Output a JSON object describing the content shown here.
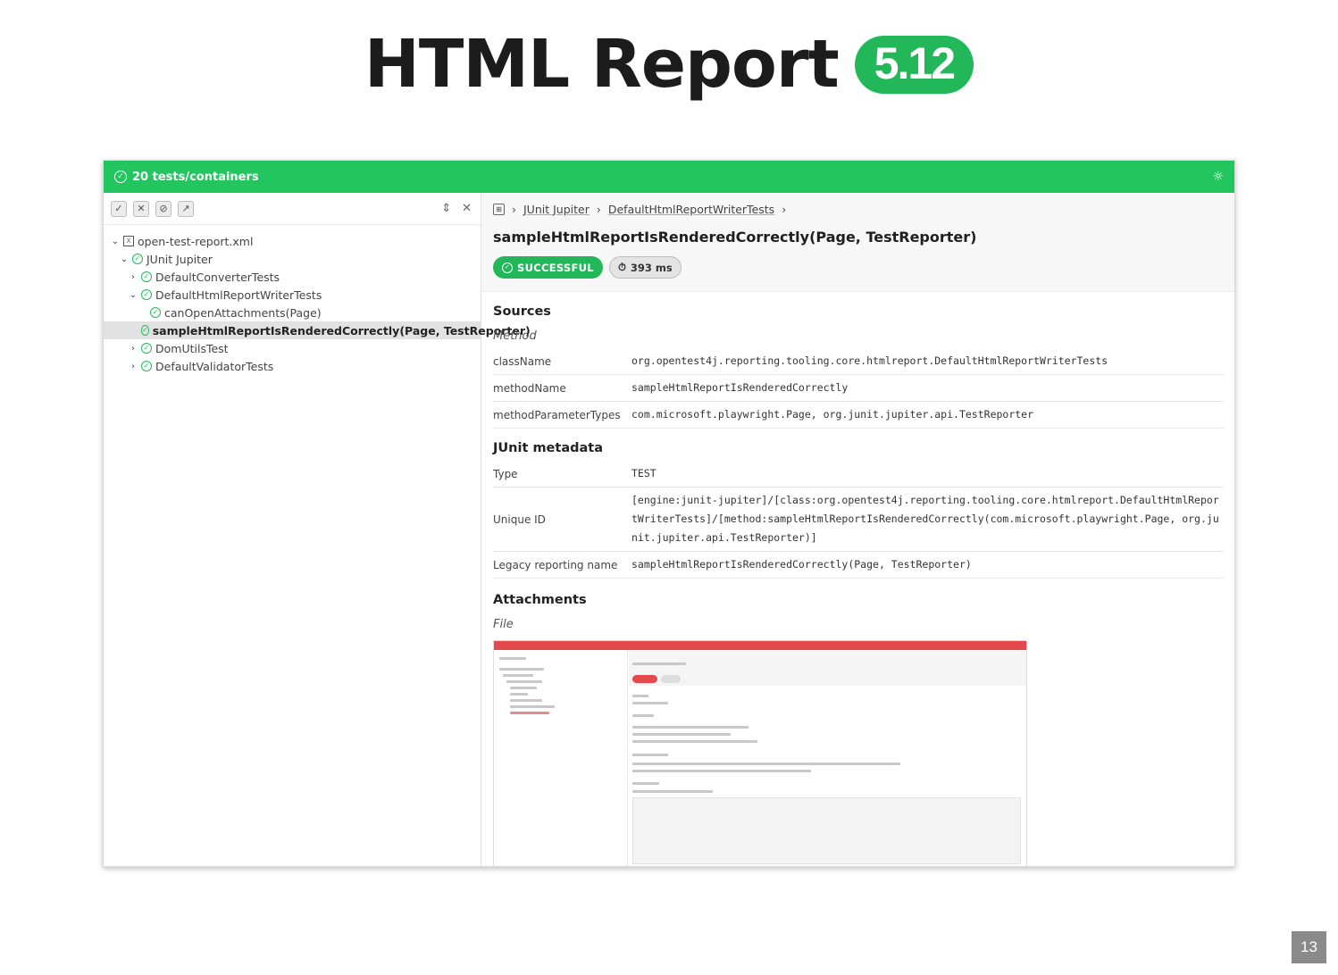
{
  "slide": {
    "title": "HTML Report",
    "version": "5.12",
    "page_number": "13"
  },
  "colors": {
    "success_green": "#22b85a",
    "topbar_green": "#22c55e",
    "failed_red": "#e5484d"
  },
  "topbar": {
    "summary": "20 tests/containers",
    "theme_icon": "sun-icon"
  },
  "sidebar": {
    "tree": [
      {
        "label": "open-test-report.xml",
        "level": 0,
        "chevron": "down",
        "icon": "file-icon"
      },
      {
        "label": "JUnit Jupiter",
        "level": 1,
        "chevron": "down",
        "icon": "check-circle-icon"
      },
      {
        "label": "DefaultConverterTests",
        "level": 2,
        "chevron": "right",
        "icon": "check-circle-icon"
      },
      {
        "label": "DefaultHtmlReportWriterTests",
        "level": 2,
        "chevron": "down",
        "icon": "check-circle-icon"
      },
      {
        "label": "canOpenAttachments(Page)",
        "level": 3,
        "chevron": "",
        "icon": "check-circle-icon"
      },
      {
        "label": "sampleHtmlReportIsRenderedCorrectly(Page, TestReporter)",
        "level": 3,
        "chevron": "",
        "icon": "check-circle-icon",
        "selected": true
      },
      {
        "label": "DomUtilsTest",
        "level": 2,
        "chevron": "right",
        "icon": "check-circle-icon"
      },
      {
        "label": "DefaultValidatorTests",
        "level": 2,
        "chevron": "right",
        "icon": "check-circle-icon"
      }
    ]
  },
  "main": {
    "breadcrumb": [
      "JUnit Jupiter",
      "DefaultHtmlReportWriterTests"
    ],
    "test_title": "sampleHtmlReportIsRenderedCorrectly(Page, TestReporter)",
    "status": "SUCCESSFUL",
    "duration": "393 ms",
    "sources": {
      "heading": "Sources",
      "subheading": "Method",
      "rows": [
        {
          "key": "className",
          "value": "org.opentest4j.reporting.tooling.core.htmlreport.DefaultHtmlReportWriterTests"
        },
        {
          "key": "methodName",
          "value": "sampleHtmlReportIsRenderedCorrectly"
        },
        {
          "key": "methodParameterTypes",
          "value": "com.microsoft.playwright.Page, org.junit.jupiter.api.TestReporter"
        }
      ]
    },
    "junit_metadata": {
      "heading": "JUnit metadata",
      "rows": [
        {
          "key": "Type",
          "value": "TEST"
        },
        {
          "key": "Unique ID",
          "value": "[engine:junit-jupiter]/[class:org.opentest4j.reporting.tooling.core.htmlreport.DefaultHtmlReportWriterTests]/[method:sampleHtmlReportIsRenderedCorrectly(com.microsoft.playwright.Page, org.junit.jupiter.api.TestReporter)]"
        },
        {
          "key": "Legacy reporting name",
          "value": "sampleHtmlReportIsRenderedCorrectly(Page, TestReporter)"
        }
      ]
    },
    "attachments": {
      "heading": "Attachments",
      "subheading": "File"
    }
  }
}
